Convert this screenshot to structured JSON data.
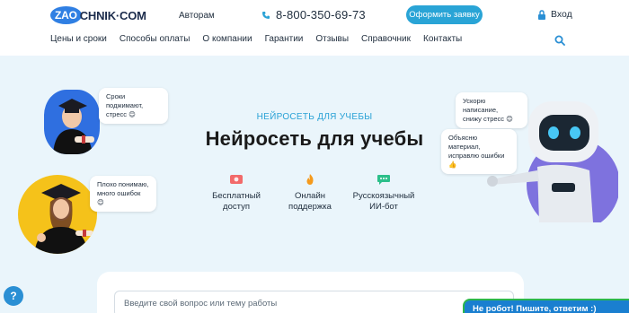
{
  "header": {
    "logo_left": "ZAO",
    "logo_right": "CHNIK·COM",
    "authors_link": "Авторам",
    "phone": "8-800-350-69-73",
    "order_button": "Оформить заявку",
    "login": "Вход"
  },
  "nav": {
    "items": [
      "Цены и сроки",
      "Способы оплаты",
      "О компании",
      "Гарантии",
      "Отзывы",
      "Справочник",
      "Контакты"
    ]
  },
  "hero": {
    "kicker": "НЕЙРОСЕТЬ ДЛЯ УЧЕБЫ",
    "title": "Нейросеть для учебы",
    "features": [
      {
        "line1": "Бесплатный",
        "line2": "доступ",
        "icon": "ticket-icon"
      },
      {
        "line1": "Онлайн",
        "line2": "поддержка",
        "icon": "fire-icon"
      },
      {
        "line1": "Русскоязычный",
        "line2": "ИИ-бот",
        "icon": "chat-icon"
      }
    ],
    "bubbles": {
      "top_left_1": "Сроки поджимают,",
      "top_left_2": "стресс 😊",
      "bottom_left_1": "Плохо понимаю,",
      "bottom_left_2": "много ошибок 😊",
      "top_right_1": "Ускорю написание,",
      "top_right_2": "снижу стресс 😊",
      "mid_right_1": "Объясню материал,",
      "mid_right_2": "исправлю ошибки 👍"
    }
  },
  "question": {
    "placeholder": "Введите свой вопрос или тему работы"
  },
  "widgets": {
    "help": "?",
    "chat": "Не робот! Пишите, ответим :)"
  },
  "colors": {
    "accent": "#29a4d6",
    "brand_blue": "#2f7fe3",
    "hero_bg": "#eaf5fb",
    "chat_bg": "#1a7fd0"
  }
}
